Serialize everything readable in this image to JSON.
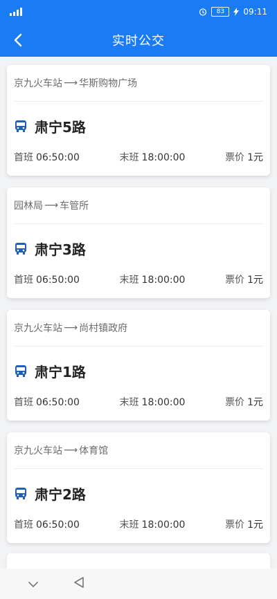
{
  "status": {
    "battery": "83",
    "time": "09:11"
  },
  "header": {
    "title": "实时公交"
  },
  "routes": [
    {
      "from": "京九火车站",
      "to": "华斯购物广场",
      "name": "肃宁5路",
      "first_label": "首班",
      "first_time": "06:50:00",
      "last_label": "末班",
      "last_time": "18:00:00",
      "fare_label": "票价",
      "fare": "1元"
    },
    {
      "from": "园林局",
      "to": "车管所",
      "name": "肃宁3路",
      "first_label": "首班",
      "first_time": "06:50:00",
      "last_label": "末班",
      "last_time": "18:00:00",
      "fare_label": "票价",
      "fare": "1元"
    },
    {
      "from": "京九火车站",
      "to": "尚村镇政府",
      "name": "肃宁1路",
      "first_label": "首班",
      "first_time": "06:50:00",
      "last_label": "末班",
      "last_time": "18:00:00",
      "fare_label": "票价",
      "fare": "1元"
    },
    {
      "from": "京九火车站",
      "to": "体育馆",
      "name": "肃宁2路",
      "first_label": "首班",
      "first_time": "06:50:00",
      "last_label": "末班",
      "last_time": "18:00:00",
      "fare_label": "票价",
      "fare": "1元"
    }
  ],
  "colors": {
    "primary": "#1a7cf5",
    "bus_icon": "#1f5fb8"
  },
  "icons": {
    "back": "chevron-left-icon",
    "bus": "bus-icon",
    "nav_down": "chevron-down-icon",
    "nav_back": "triangle-back-icon"
  }
}
